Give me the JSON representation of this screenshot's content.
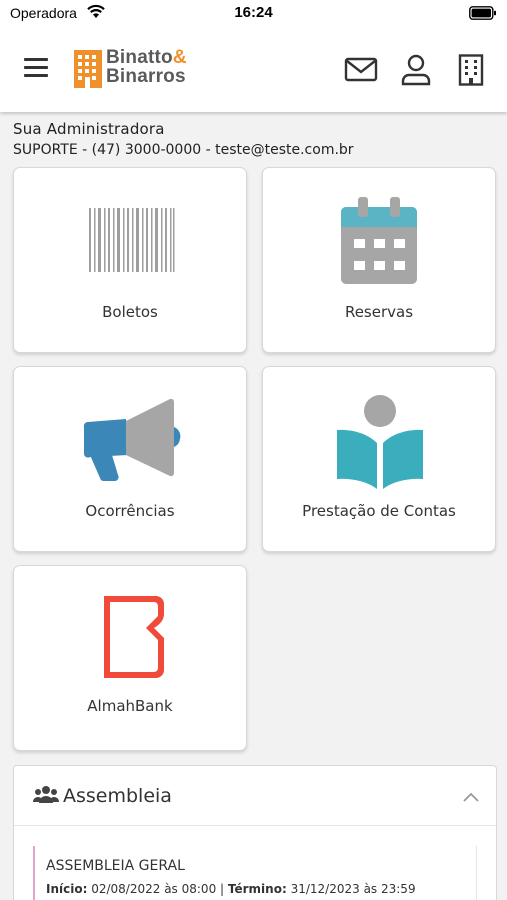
{
  "status_bar": {
    "carrier": "Operadora",
    "time": "16:24"
  },
  "header": {
    "logo_line1": "Binatto",
    "logo_amp": "&",
    "logo_line2": "Binarros",
    "icons": [
      "menu-icon",
      "mail-icon",
      "user-icon",
      "building-icon"
    ]
  },
  "admin": {
    "title": "Sua Administradora",
    "contact": "SUPORTE - (47) 3000-0000 - teste@teste.com.br"
  },
  "cards": [
    {
      "label": "Boletos",
      "icon": "barcode-icon"
    },
    {
      "label": "Reservas",
      "icon": "calendar-icon"
    },
    {
      "label": "Ocorrências",
      "icon": "megaphone-icon"
    },
    {
      "label": "Prestação de Contas",
      "icon": "reading-book-icon"
    },
    {
      "label": "AlmahBank",
      "icon": "almahbank-logo"
    }
  ],
  "assembleia": {
    "title": "Assembleia",
    "icon": "users-icon",
    "items": [
      {
        "title": "ASSEMBLEIA GERAL",
        "inicio_label": "Início:",
        "inicio": "02/08/2022 às 08:00",
        "separator": "|",
        "termino_label": "Término:",
        "termino": "31/12/2023 às 23:59"
      }
    ]
  },
  "colors": {
    "brand_orange": "#f0902b",
    "calendar_teal": "#5ab4c4",
    "megaphone_blue": "#3b87b8",
    "book_teal": "#3aaebc",
    "almah_red": "#ef4a3a",
    "accent_pink": "#e3a6c9"
  }
}
